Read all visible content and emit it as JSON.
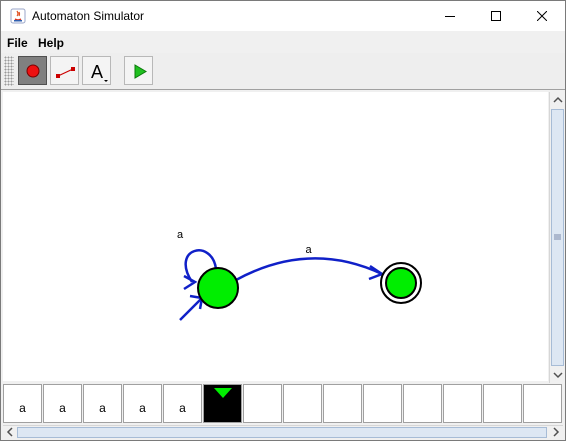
{
  "window": {
    "title": "Automaton Simulator"
  },
  "menu": {
    "items": [
      "File",
      "Help"
    ]
  },
  "toolbar": {
    "tools": [
      "add-state",
      "add-transition",
      "text-tool",
      "run"
    ],
    "selected": "add-state",
    "text_tool_glyph": "A"
  },
  "automaton": {
    "states": [
      {
        "id": "q0",
        "initial": true,
        "accepting": false,
        "color": "#00ee00"
      },
      {
        "id": "q1",
        "initial": false,
        "accepting": true,
        "color": "#00ee00"
      }
    ],
    "transitions": [
      {
        "from": "q0",
        "to": "q0",
        "label": "a"
      },
      {
        "from": "q0",
        "to": "q1",
        "label": "a"
      }
    ],
    "edge_color": "#1020c8"
  },
  "tape": {
    "cells": [
      "a",
      "a",
      "a",
      "a",
      "a",
      "",
      "",
      "",
      "",
      "",
      "",
      "",
      "",
      ""
    ],
    "head_index": 5
  }
}
